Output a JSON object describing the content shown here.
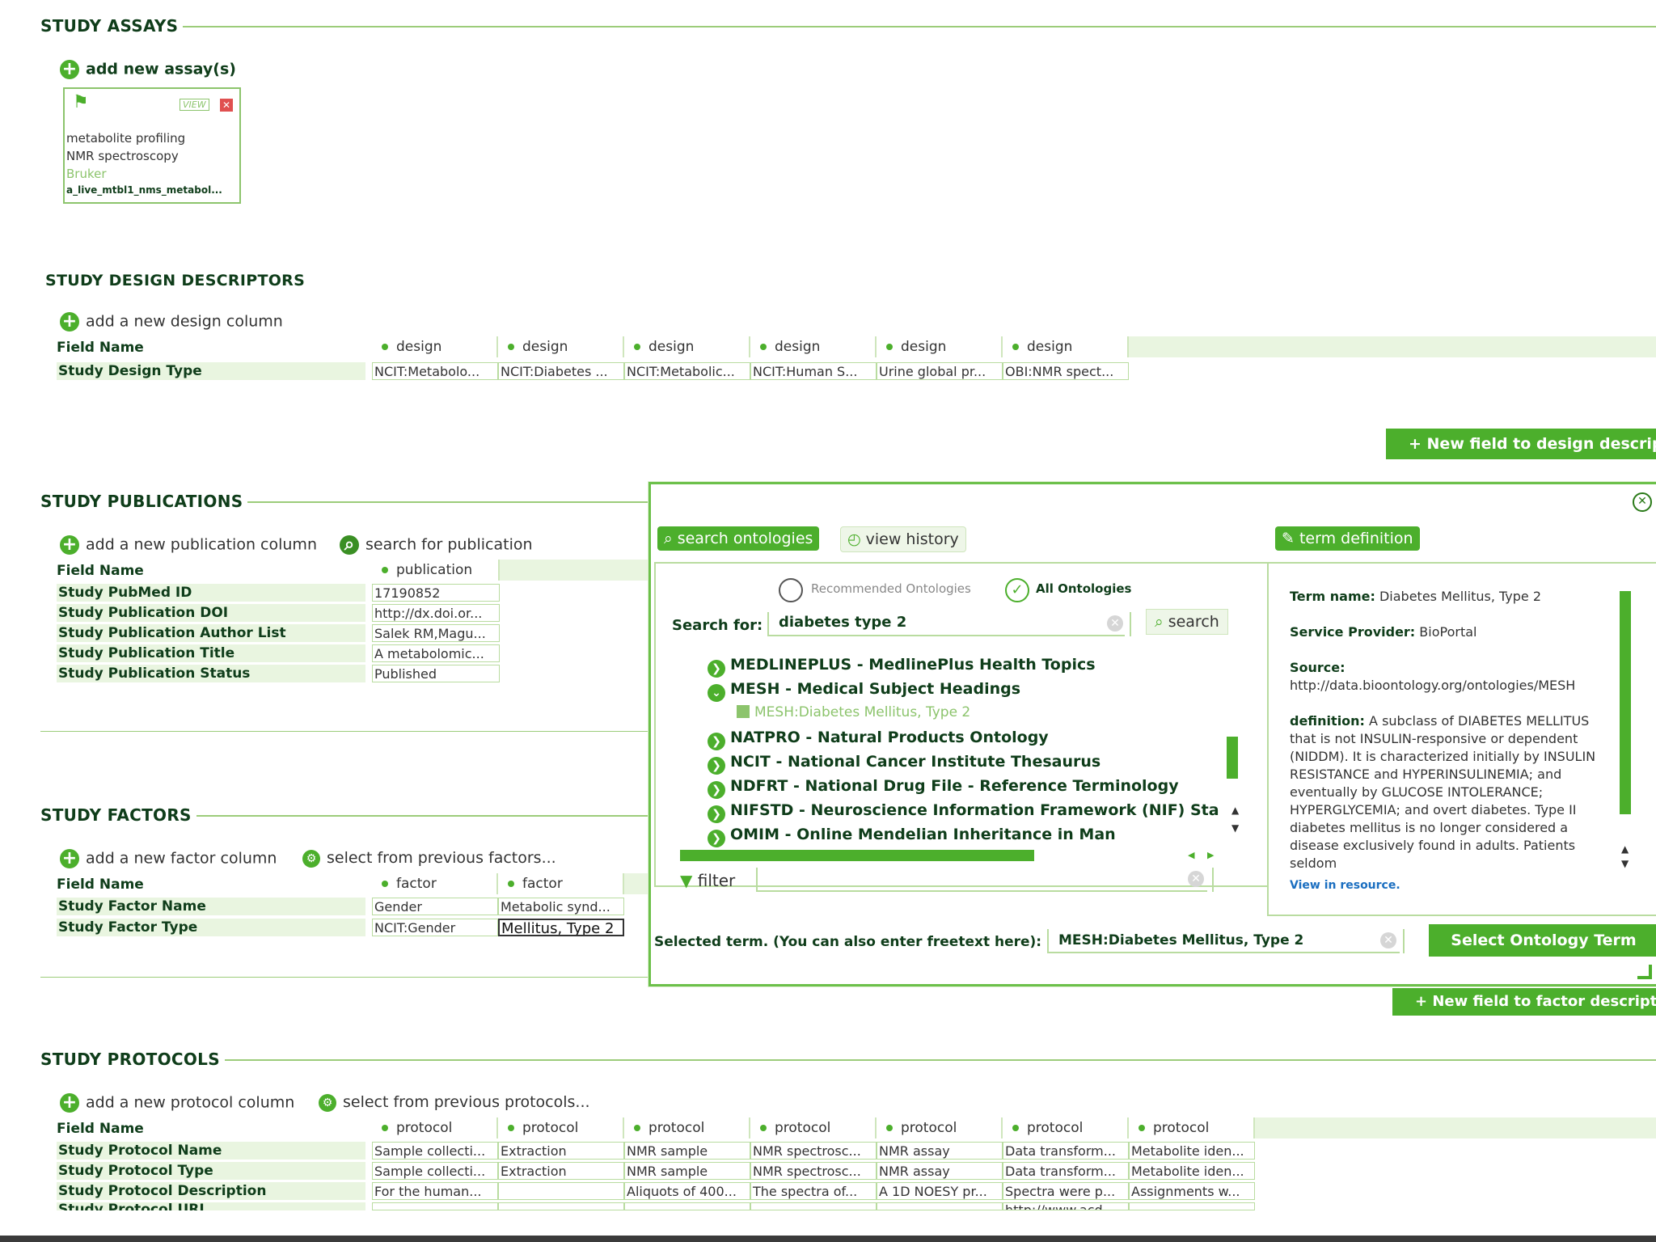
{
  "assays": {
    "title": "STUDY ASSAYS",
    "add_label": "add new assay(s)",
    "card": {
      "view_label": "VIEW",
      "lines": [
        "metabolite profiling",
        "NMR spectroscopy",
        "Bruker",
        "a_live_mtbl1_nms_metabol..."
      ]
    }
  },
  "design": {
    "title": "STUDY DESIGN DESCRIPTORS",
    "add_label": "add a new design column",
    "field_name": "Field Name",
    "column_label": "design",
    "column_labels": [
      "design",
      "design",
      "design",
      "design",
      "design",
      "design"
    ],
    "row_label": "Study Design Type",
    "cells": [
      "NCIT:Metabolo...",
      "NCIT:Diabetes ...",
      "NCIT:Metabolic...",
      "NCIT:Human S...",
      "Urine global pr...",
      "OBI:NMR spect..."
    ],
    "new_field_button": "+ New field to design descript"
  },
  "publications": {
    "title": "STUDY PUBLICATIONS",
    "add_label": "add a new publication column",
    "search_label": "search for publication",
    "field_name": "Field Name",
    "column_label": "publication",
    "rows": [
      {
        "label": "Study PubMed ID",
        "value": "17190852"
      },
      {
        "label": "Study Publication DOI",
        "value": "http://dx.doi.or..."
      },
      {
        "label": "Study Publication Author List",
        "value": "Salek RM,Magu..."
      },
      {
        "label": "Study Publication Title",
        "value": "A metabolomic..."
      },
      {
        "label": "Study Publication Status",
        "value": "Published"
      }
    ]
  },
  "factors": {
    "title": "STUDY FACTORS",
    "add_label": "add a new factor column",
    "select_label": "select from previous factors...",
    "field_name": "Field Name",
    "columns": [
      "factor",
      "factor"
    ],
    "rows": [
      {
        "label": "Study Factor Name",
        "values": [
          "Gender",
          "Metabolic synd..."
        ]
      },
      {
        "label": "Study Factor Type",
        "values": [
          "NCIT:Gender",
          "Mellitus, Type 2"
        ]
      }
    ],
    "new_field_button": "+ New field to factor descript"
  },
  "protocols": {
    "title": "STUDY PROTOCOLS",
    "add_label": "add a new protocol column",
    "select_label": "select from previous protocols...",
    "field_name": "Field Name",
    "columns": [
      "protocol",
      "protocol",
      "protocol",
      "protocol",
      "protocol",
      "protocol",
      "protocol"
    ],
    "rows": [
      {
        "label": "Study Protocol Name",
        "values": [
          "Sample collecti...",
          "Extraction",
          "NMR sample",
          "NMR spectrosc...",
          "NMR assay",
          "Data transform...",
          "Metabolite iden..."
        ]
      },
      {
        "label": "Study Protocol Type",
        "values": [
          "Sample collecti...",
          "Extraction",
          "NMR sample",
          "NMR spectrosc...",
          "NMR assay",
          "Data transform...",
          "Metabolite iden..."
        ]
      },
      {
        "label": "Study Protocol Description",
        "values": [
          "For the human...",
          "",
          "Aliquots of 400...",
          "The spectra of...",
          "A 1D NOESY pr...",
          "Spectra were p...",
          "Assignments w..."
        ]
      },
      {
        "label": "Study Protocol URI",
        "values": [
          "",
          "",
          "",
          "",
          "",
          "http://www.acd...",
          ""
        ]
      }
    ]
  },
  "dialog": {
    "tab_search": "search ontologies",
    "tab_history": "view history",
    "tab_definition": "term definition",
    "radio_recommended": "Recommended Ontologies",
    "radio_all": "All Ontologies",
    "search_for_label": "Search for:",
    "search_value": "diabetes type 2",
    "search_button": "search",
    "ontologies": [
      "MEDLINEPLUS - MedlinePlus Health Topics",
      "MESH - Medical Subject Headings",
      "NATPRO - Natural Products Ontology",
      "NCIT - National Cancer Institute Thesaurus",
      "NDFRT - National Drug File - Reference Terminology",
      "NIFSTD - Neuroscience Information Framework (NIF) Sta",
      "OMIM - Online Mendelian Inheritance in Man"
    ],
    "sub_term": "MESH:Diabetes Mellitus, Type 2",
    "filter_label": "filter",
    "definition": {
      "term_name_label": "Term name:",
      "term_name": "Diabetes Mellitus, Type 2",
      "provider_label": "Service Provider:",
      "provider": "BioPortal",
      "source_label": "Source:",
      "source": "http://data.bioontology.org/ontologies/MESH",
      "definition_label": "definition:",
      "definition": "A subclass of DIABETES MELLITUS that is not INSULIN-responsive or dependent (NIDDM). It is characterized initially by INSULIN RESISTANCE and HYPERINSULINEMIA; and eventually by GLUCOSE INTOLERANCE; HYPERGLYCEMIA; and overt diabetes. Type II diabetes mellitus is no longer considered a disease exclusively found in adults. Patients seldom",
      "view_link": "View in resource."
    },
    "selected_label": "Selected term. (You can also enter freetext here):",
    "selected_value": "MESH:Diabetes Mellitus, Type 2",
    "select_button": "Select Ontology Term"
  }
}
